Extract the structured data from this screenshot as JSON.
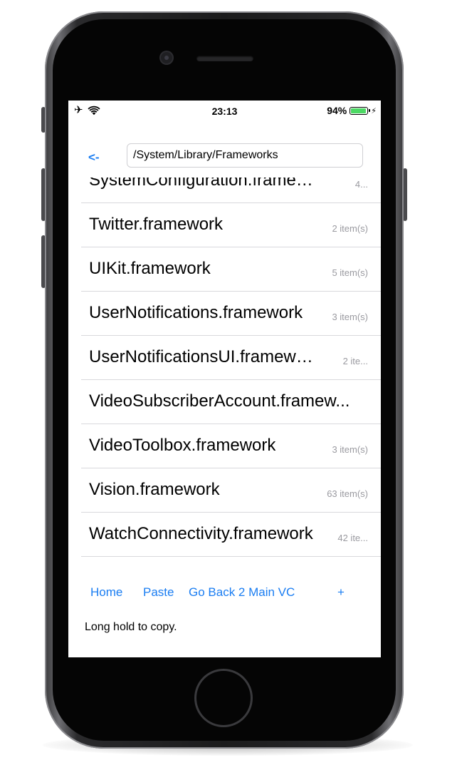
{
  "status_bar": {
    "time": "23:13",
    "battery_percent_label": "94%",
    "battery_level": 0.94,
    "icons": [
      "airplane-icon",
      "wifi-icon",
      "battery-icon",
      "bolt-icon"
    ]
  },
  "nav": {
    "back_label": "<-",
    "path_value": "/System/Library/Frameworks"
  },
  "files": [
    {
      "name": "SystemConfiguration.framework",
      "count": "4..."
    },
    {
      "name": "Twitter.framework",
      "count": "2 item(s)"
    },
    {
      "name": "UIKit.framework",
      "count": "5 item(s)"
    },
    {
      "name": "UserNotifications.framework",
      "count": "3 item(s)"
    },
    {
      "name": "UserNotificationsUI.framework",
      "count": "2 ite..."
    },
    {
      "name": "VideoSubscriberAccount.framew...",
      "count": ""
    },
    {
      "name": "VideoToolbox.framework",
      "count": "3 item(s)"
    },
    {
      "name": "Vision.framework",
      "count": "63 item(s)"
    },
    {
      "name": "WatchConnectivity.framework",
      "count": "42 ite..."
    }
  ],
  "toolbar": {
    "home_label": "Home",
    "paste_label": "Paste",
    "go_back_label": "Go Back 2 Main VC",
    "add_label": "+"
  },
  "hint": "Long hold to copy.",
  "colors": {
    "accent": "#1a7df2",
    "battery_green": "#4cd964",
    "secondary_text": "#9a9aa0"
  }
}
